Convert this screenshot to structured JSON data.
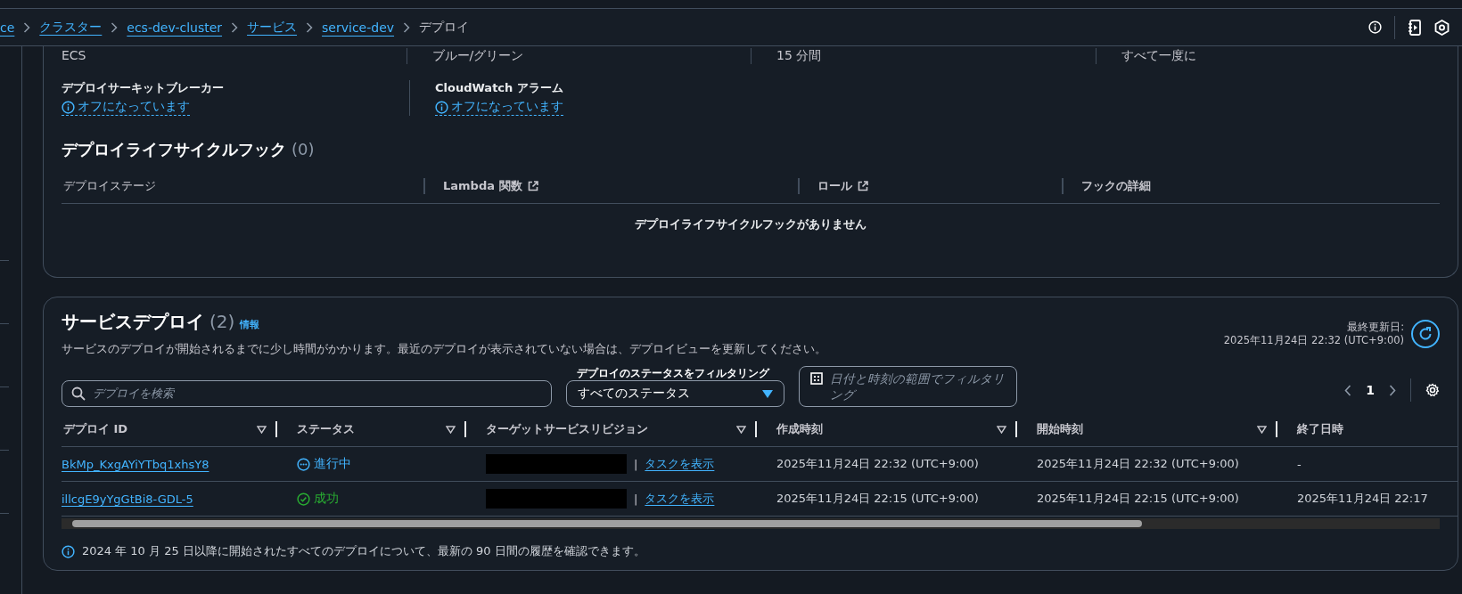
{
  "breadcrumbs": [
    {
      "label": "ce",
      "link": true
    },
    {
      "label": "クラスター",
      "link": true
    },
    {
      "label": "ecs-dev-cluster",
      "link": true
    },
    {
      "label": "サービス",
      "link": true
    },
    {
      "label": "service-dev",
      "link": true
    },
    {
      "label": "デプロイ",
      "link": false
    }
  ],
  "summary": {
    "values": [
      "ECS",
      "ブルー/グリーン",
      "15 分間",
      "すべて一度に"
    ],
    "fields": [
      {
        "label": "デプロイサーキットブレーカー",
        "value": "オフになっています"
      },
      {
        "label": "CloudWatch アラーム",
        "value": "オフになっています"
      }
    ]
  },
  "lifecycle": {
    "title": "デプロイライフサイクルフック",
    "count": "(0)",
    "columns": [
      {
        "label": "デプロイステージ",
        "external": false
      },
      {
        "label": "Lambda 関数",
        "external": true
      },
      {
        "label": "ロール",
        "external": true
      },
      {
        "label": "フックの詳細",
        "external": false
      }
    ],
    "empty": "デプロイライフサイクルフックがありません"
  },
  "deployments": {
    "title": "サービスデプロイ",
    "count": "(2)",
    "info": "情報",
    "description": "サービスのデプロイが開始されるまでに少し時間がかかります。最近のデプロイが表示されていない場合は、デプロイビューを更新してください。",
    "last_updated_label": "最終更新日:",
    "last_updated": "2025年11月24日 22:32 (UTC+9:00)",
    "search": {
      "placeholder": "デプロイを検索"
    },
    "filter": {
      "label": "デプロイのステータスをフィルタリング",
      "value": "すべてのステータス"
    },
    "date_filter": {
      "placeholder": "日付と時刻の範囲でフィルタリング"
    },
    "page": "1",
    "columns": [
      {
        "label": "デプロイ ID",
        "sortable": true
      },
      {
        "label": "ステータス",
        "sortable": true
      },
      {
        "label": "ターゲットサービスリビジョン",
        "sortable": true
      },
      {
        "label": "作成時刻",
        "sortable": true
      },
      {
        "label": "開始時刻",
        "sortable": true
      },
      {
        "label": "終了日時",
        "sortable": false
      }
    ],
    "rows": [
      {
        "id": "BkMp_KxgAYiYTbq1xhsY8",
        "status": "進行中",
        "kind": "in_progress",
        "separator": "|",
        "revision_link": "タスクを表示",
        "created": "2025年11月24日 22:32 (UTC+9:00)",
        "started": "2025年11月24日 22:32 (UTC+9:00)",
        "ended": "-"
      },
      {
        "id": "illcgE9yYgGtBi8-GDL-5",
        "status": "成功",
        "kind": "success",
        "separator": "|",
        "revision_link": "タスクを表示",
        "created": "2025年11月24日 22:15 (UTC+9:00)",
        "started": "2025年11月24日 22:15 (UTC+9:00)",
        "ended": "2025年11月24日 22:17"
      }
    ],
    "footer": "2024 年 10 月 25 日以降に開始されたすべてのデプロイについて、最新の 90 日間の履歴を確認できます。"
  }
}
